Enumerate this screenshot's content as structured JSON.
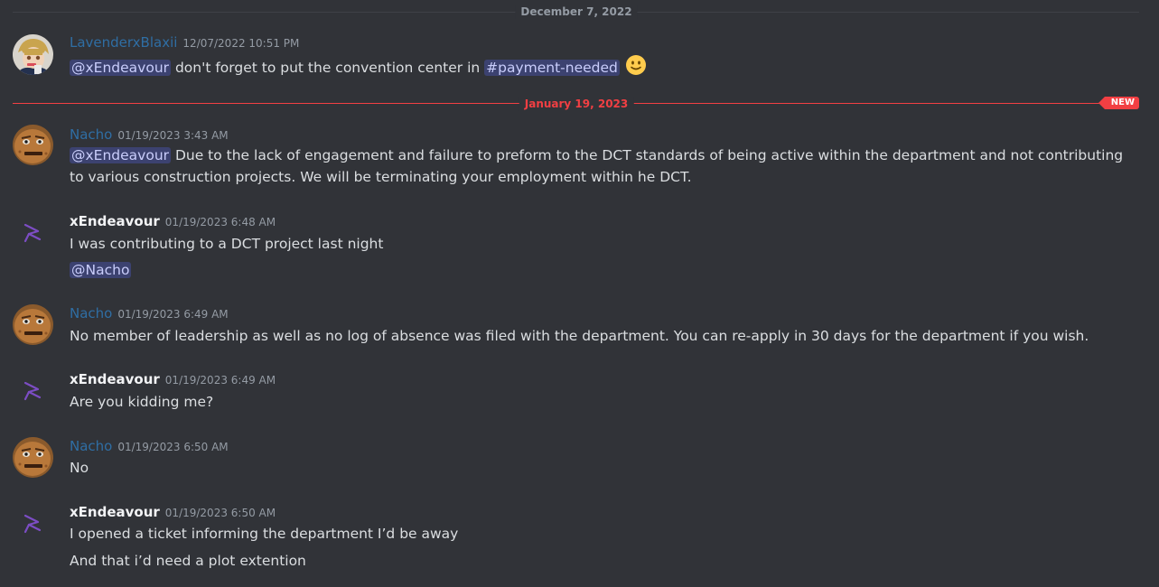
{
  "dividers": {
    "first_date": "December 7, 2022",
    "second_date": "January 19, 2023",
    "new_badge": "NEW"
  },
  "messages": [
    {
      "username": "LavenderxBlaxii",
      "timestamp": "12/07/2022 10:51 PM",
      "mention": "@xEndeavour",
      "text": " don't forget to put the convention center in ",
      "channel_mention": "#payment-needed",
      "emoji": "slightly-smiling-face"
    },
    {
      "username": "Nacho",
      "timestamp": "01/19/2023 3:43 AM",
      "mention": "@xEndeavour",
      "text": " Due to the lack of engagement and failure to preform to the DCT standards of being active within the department and not contributing to various construction projects. We will be terminating your employment within he DCT."
    },
    {
      "username": "xEndeavour",
      "timestamp": "01/19/2023 6:48 AM",
      "text": "I was contributing to a DCT project last night",
      "mention_line": "@Nacho"
    },
    {
      "username": "Nacho",
      "timestamp": "01/19/2023 6:49 AM",
      "text": "No member of leadership as well as no log of absence was filed with the department. You can re-apply in 30 days for the department if you wish."
    },
    {
      "username": "xEndeavour",
      "timestamp": "01/19/2023 6:49 AM",
      "text": "Are you kidding me?"
    },
    {
      "username": "Nacho",
      "timestamp": "01/19/2023 6:50 AM",
      "text": "No"
    },
    {
      "username": "xEndeavour",
      "timestamp": "01/19/2023 6:50 AM",
      "text": "I opened a ticket informing the department I’d be away",
      "text2": "And that i’d need a plot extention"
    }
  ],
  "colors": {
    "background": "#313338",
    "new_red": "#f23f43",
    "mention_bg": "#3c4270",
    "nacho_name": "#2f6ea4"
  }
}
